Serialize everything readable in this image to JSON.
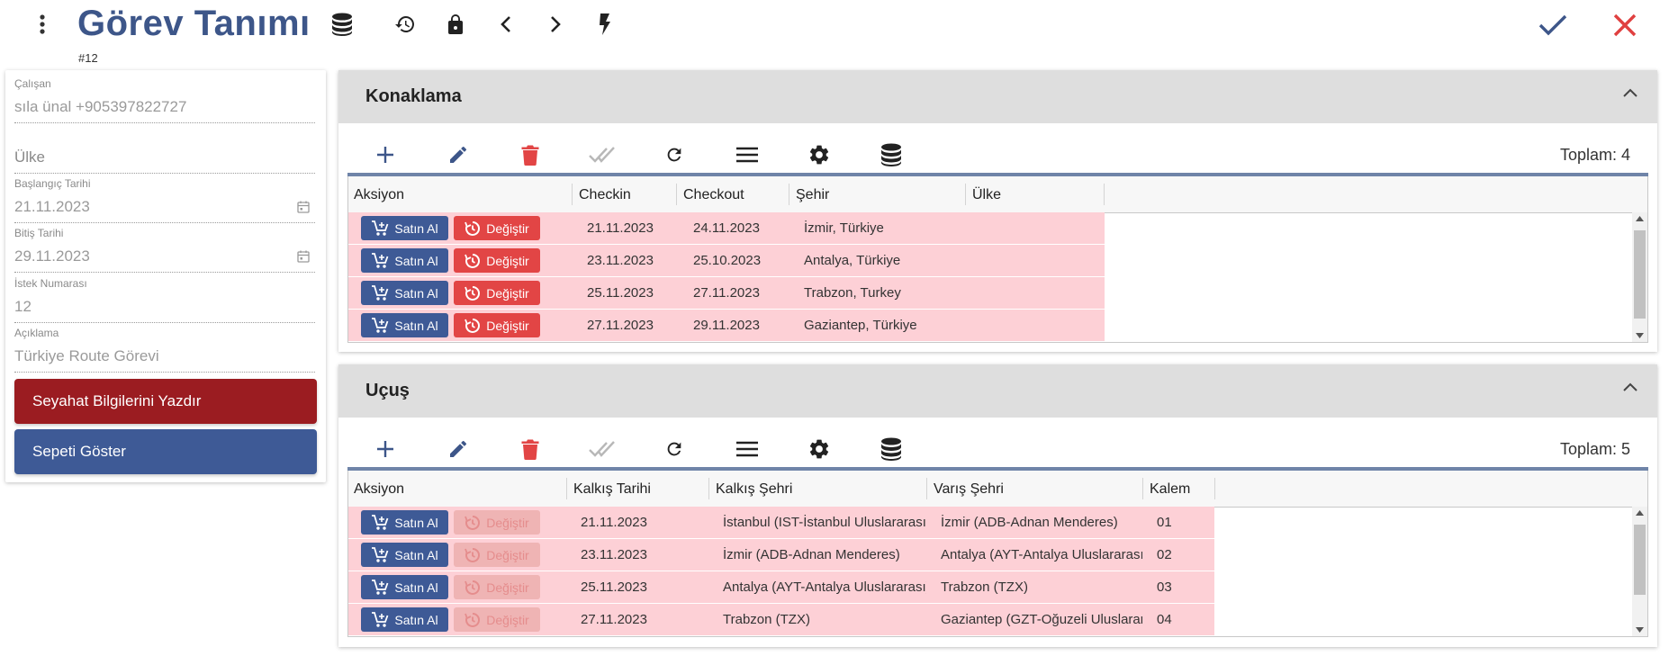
{
  "header": {
    "title": "Görev Tanımı",
    "record_no": "#12"
  },
  "form": {
    "employee": {
      "label": "Çalışan",
      "value": "sıla ünal +905397822727"
    },
    "country": {
      "placeholder": "Ülke"
    },
    "start_date": {
      "label": "Başlangıç Tarihi",
      "value": "21.11.2023"
    },
    "end_date": {
      "label": "Bitiş Tarihi",
      "value": "29.11.2023"
    },
    "request_no": {
      "label": "İstek Numarası",
      "value": "12"
    },
    "description": {
      "label": "Açıklama",
      "value": "Türkiye Route Görevi"
    },
    "print_button": "Seyahat Bilgilerini Yazdır",
    "basket_button": "Sepeti Göster"
  },
  "colors": {
    "brand": "#3d5689",
    "print_button": "#9b1c21",
    "basket_button": "#3e5a96",
    "row_highlight": "#fdd0d6",
    "change_button": "#e24545",
    "confirm": "#3d5689",
    "cancel": "#e04040"
  },
  "accommodation": {
    "title": "Konaklama",
    "total": "Toplam: 4",
    "columns": [
      "Aksiyon",
      "Checkin",
      "Checkout",
      "Şehir",
      "Ülke"
    ],
    "buy_label": "Satın Al",
    "change_label": "Değiştir",
    "rows": [
      {
        "checkin": "21.11.2023",
        "checkout": "24.11.2023",
        "city": "İzmir, Türkiye",
        "country": ""
      },
      {
        "checkin": "23.11.2023",
        "checkout": "25.10.2023",
        "city": "Antalya, Türkiye",
        "country": ""
      },
      {
        "checkin": "25.11.2023",
        "checkout": "27.11.2023",
        "city": "Trabzon, Turkey",
        "country": ""
      },
      {
        "checkin": "27.11.2023",
        "checkout": "29.11.2023",
        "city": "Gaziantep, Türkiye",
        "country": ""
      }
    ]
  },
  "flight": {
    "title": "Uçuş",
    "total": "Toplam: 5",
    "columns": [
      "Aksiyon",
      "Kalkış Tarihi",
      "Kalkış Şehri",
      "Varış Şehri",
      "Kalem"
    ],
    "buy_label": "Satın Al",
    "change_label": "Değiştir",
    "rows": [
      {
        "date": "21.11.2023",
        "from": "İstanbul (IST-İstanbul Uluslararası)",
        "to": "İzmir (ADB-Adnan Menderes)",
        "item": "01"
      },
      {
        "date": "23.11.2023",
        "from": "İzmir (ADB-Adnan Menderes)",
        "to": "Antalya (AYT-Antalya Uluslararası)",
        "item": "02"
      },
      {
        "date": "25.11.2023",
        "from": "Antalya (AYT-Antalya Uluslararası)",
        "to": "Trabzon (TZX)",
        "item": "03"
      },
      {
        "date": "27.11.2023",
        "from": "Trabzon (TZX)",
        "to": "Gaziantep (GZT-Oğuzeli Uluslararası)",
        "item": "04"
      }
    ]
  },
  "toolbar_icons": [
    "add-icon",
    "edit-icon",
    "delete-icon",
    "approve-icon",
    "refresh-icon",
    "menu-icon",
    "settings-icon",
    "database-icon"
  ]
}
